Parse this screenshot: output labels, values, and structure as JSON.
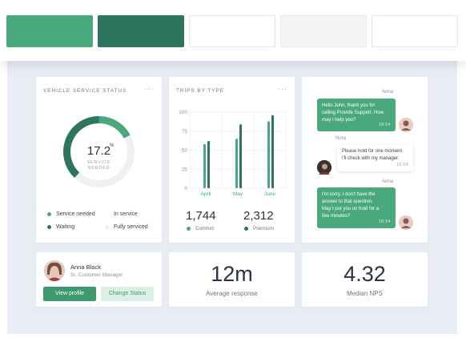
{
  "colors": {
    "accent": "#4aa97c",
    "accent_dark": "#2e7560",
    "swatches": [
      "#4aa97c",
      "#2e7560",
      "#ffffff",
      "#f3f4f6",
      "#ffffff"
    ]
  },
  "vehicle": {
    "title": "VEHICLE SERVICE STATUS",
    "menu": "···",
    "percent_value": "17.2",
    "percent_unit": "%",
    "center_label_1": "SERVICE",
    "center_label_2": "NEEDED",
    "percent": 17.2,
    "legend": [
      {
        "label": "Service needed",
        "color": "#4aa97c"
      },
      {
        "label": "In service",
        "color": "#ffffff"
      },
      {
        "label": "Waiting",
        "color": "#2e7560"
      },
      {
        "label": "Fully serviced",
        "color": "#eef0f3"
      }
    ]
  },
  "trips": {
    "title": "TRIPS BY TYPE",
    "menu": "···",
    "comfort_total": "1,744",
    "comfort_label": "Comfort",
    "premium_total": "2,312",
    "premium_label": "Premium"
  },
  "chart_data": {
    "type": "bar",
    "categories": [
      "April",
      "May",
      "June"
    ],
    "series": [
      {
        "name": "Comfort",
        "values": [
          58,
          65,
          88
        ],
        "color": "#4aa97c"
      },
      {
        "name": "Premium",
        "values": [
          62,
          84,
          96
        ],
        "color": "#2e7560"
      }
    ],
    "yticks": [
      "0",
      "25",
      "50",
      "75",
      "100"
    ],
    "ylim": [
      0,
      100
    ],
    "grid": true
  },
  "chat": {
    "messages": [
      {
        "sender": "Anna",
        "text_lines": [
          "Hello John, thank you for",
          "calling Provide Support. How",
          "may I help you?"
        ],
        "time": "18:54",
        "side": "agent"
      },
      {
        "sender": "Nora",
        "text_lines": [
          "Please hold for one moment.",
          "I'll check with my manager."
        ],
        "time": "18:54",
        "side": "customer"
      },
      {
        "sender": "Anna",
        "text_lines": [
          "I'm sorry, I don't have the",
          "answer to that question.",
          "May I put you on hold for a",
          "few minutes?"
        ],
        "time": "18:54",
        "side": "agent"
      }
    ]
  },
  "agent": {
    "name": "Anna Black",
    "role": "Sr. Customer Manager",
    "view_profile": "View profile",
    "change_status": "Change Status"
  },
  "stats": [
    {
      "value": "12m",
      "label": "Average response"
    },
    {
      "value": "4.32",
      "label": "Median NPS"
    }
  ]
}
